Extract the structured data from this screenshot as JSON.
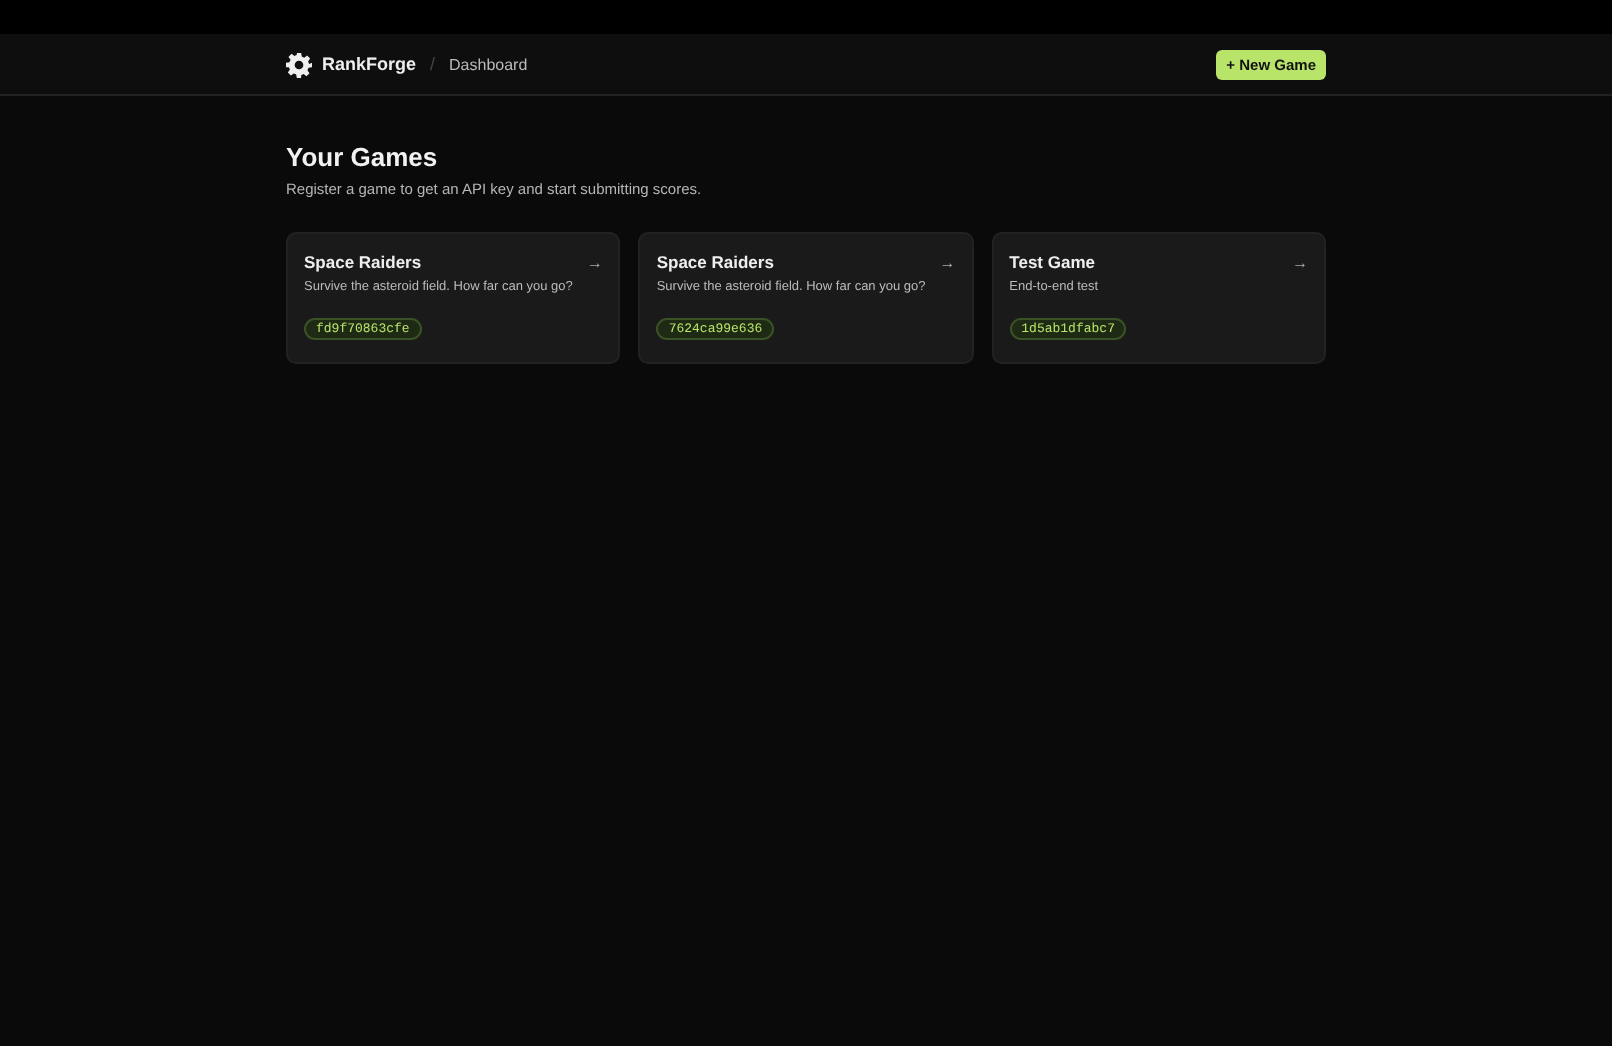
{
  "header": {
    "brand": "RankForge",
    "separator": "/",
    "breadcrumb": "Dashboard",
    "new_button": "+ New Game"
  },
  "page": {
    "title": "Your Games",
    "subtitle": "Register a game to get an API key and start submitting scores."
  },
  "games": [
    {
      "name": "Space Raiders",
      "description": "Survive the asteroid field. How far can you go?",
      "key": "fd9f70863cfe",
      "arrow": "→"
    },
    {
      "name": "Space Raiders",
      "description": "Survive the asteroid field. How far can you go?",
      "key": "7624ca99e636",
      "arrow": "→"
    },
    {
      "name": "Test Game",
      "description": "End-to-end test",
      "key": "1d5ab1dfabc7",
      "arrow": "→"
    }
  ]
}
